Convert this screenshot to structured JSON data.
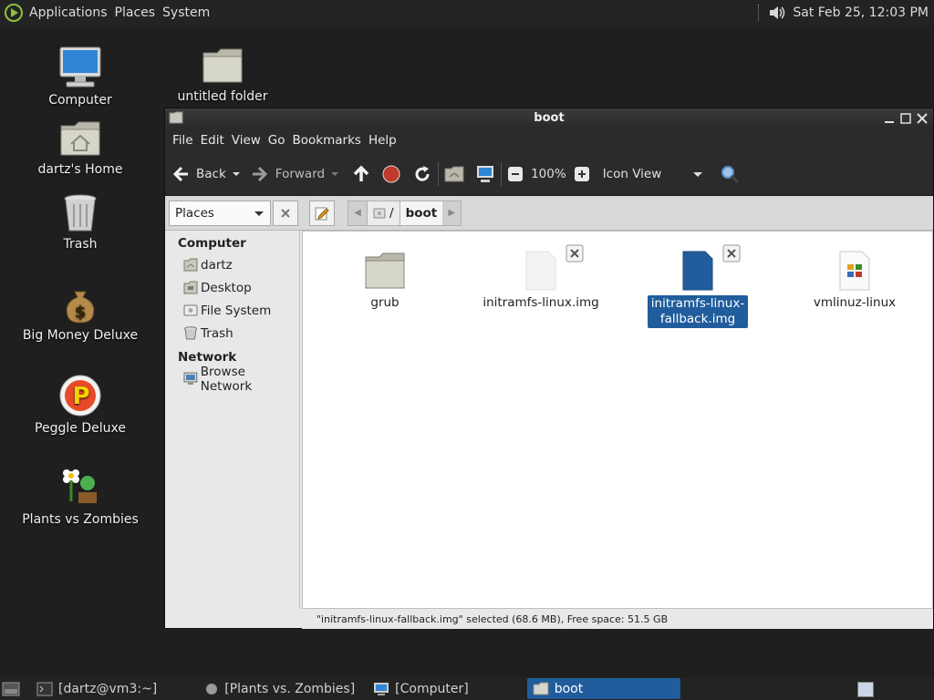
{
  "top_panel": {
    "menu": [
      "Applications",
      "Places",
      "System"
    ],
    "clock": "Sat Feb 25, 12:03 PM"
  },
  "desktop": {
    "icons": [
      "Computer",
      "untitled folder",
      "dartz's Home",
      "Trash",
      "Big Money Deluxe",
      "Peggle Deluxe",
      "Plants vs Zombies"
    ]
  },
  "window": {
    "title": "boot",
    "menu": [
      "File",
      "Edit",
      "View",
      "Go",
      "Bookmarks",
      "Help"
    ],
    "toolbar": {
      "back": "Back",
      "forward": "Forward",
      "zoom": "100%",
      "view_mode": "Icon View"
    },
    "location": {
      "places_label": "Places",
      "path": [
        "/",
        "boot"
      ]
    },
    "sidebar": {
      "sections": [
        {
          "heading": "Computer",
          "items": [
            "dartz",
            "Desktop",
            "File System",
            "Trash"
          ]
        },
        {
          "heading": "Network",
          "items": [
            "Browse Network"
          ]
        }
      ]
    },
    "files": [
      {
        "name": "grub",
        "kind": "folder"
      },
      {
        "name": "initramfs-linux.img",
        "kind": "file"
      },
      {
        "name_line1": "initramfs-linux-",
        "name_line2": "fallback.img",
        "kind": "file",
        "selected": true
      },
      {
        "name": "vmlinuz-linux",
        "kind": "executable"
      }
    ],
    "status": "\"initramfs-linux-fallback.img\" selected (68.6 MB), Free space: 51.5 GB"
  },
  "taskbar": {
    "tasks": [
      "[dartz@vm3:~]",
      "[Plants vs. Zombies]",
      "[Computer]",
      "boot"
    ]
  },
  "colors": {
    "selection": "#215d9c",
    "panel": "#232323",
    "desktop": "#1f1f1f"
  }
}
